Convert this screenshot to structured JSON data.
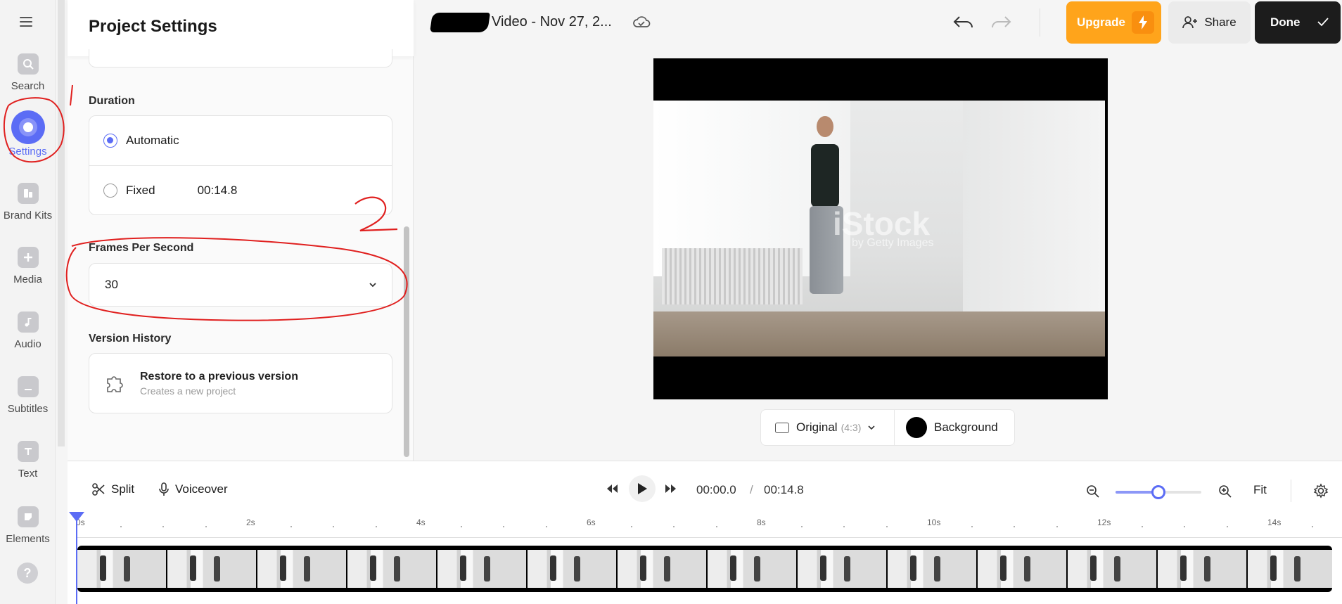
{
  "rail": {
    "items": [
      {
        "label": "Search",
        "icon": "search-icon"
      },
      {
        "label": "Settings",
        "icon": "settings-icon",
        "active": true
      },
      {
        "label": "Brand Kits",
        "icon": "brand-kit-icon"
      },
      {
        "label": "Media",
        "icon": "plus-icon"
      },
      {
        "label": "Audio",
        "icon": "music-note-icon"
      },
      {
        "label": "Subtitles",
        "icon": "subtitles-icon"
      },
      {
        "label": "Text",
        "icon": "text-icon"
      },
      {
        "label": "Elements",
        "icon": "elements-icon"
      }
    ],
    "help": "?"
  },
  "panel": {
    "title": "Project Settings",
    "duration": {
      "label": "Duration",
      "automatic": "Automatic",
      "fixed": "Fixed",
      "fixed_value": "00:14.8",
      "selected": "automatic"
    },
    "fps": {
      "label": "Frames Per Second",
      "value": "30"
    },
    "history": {
      "label": "Version History",
      "title": "Restore to a previous version",
      "subtitle": "Creates a new project"
    }
  },
  "topbar": {
    "doc_title": "Video - Nov 27, 2...",
    "upgrade": "Upgrade",
    "share": "Share",
    "done": "Done"
  },
  "preview": {
    "watermark": "iStock",
    "watermark_sub": "by Getty Images",
    "ratio_label": "Original",
    "ratio_value": "(4:3)",
    "background_label": "Background",
    "background_color": "#000000"
  },
  "timeline": {
    "split": "Split",
    "voiceover": "Voiceover",
    "current_time": "00:00.0",
    "divider": "/",
    "total_time": "00:14.8",
    "zoom_fit": "Fit",
    "zoom_level": 0.5,
    "ruler": [
      "0s",
      "2s",
      "4s",
      "6s",
      "8s",
      "10s",
      "12s",
      "14s"
    ]
  },
  "annotations": {
    "mark1": "1",
    "mark2": "2",
    "color": "#e0201f"
  },
  "colors": {
    "accent": "#5b6cf5",
    "upgrade": "#ffa41b",
    "done": "#1c1c1c"
  }
}
